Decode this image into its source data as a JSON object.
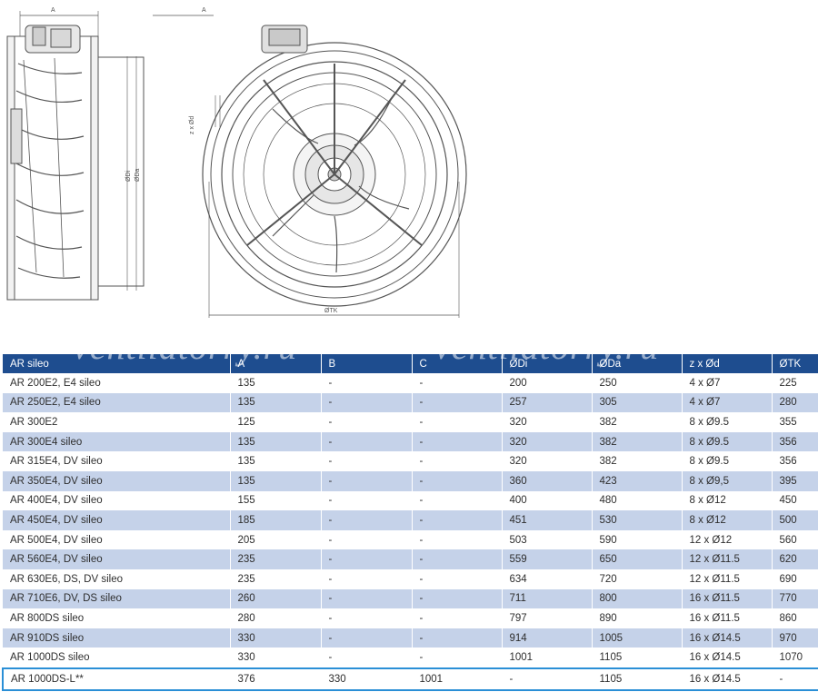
{
  "drawing": {
    "dim_a_side": "A",
    "dim_a_top": "A",
    "dim_di": "ØDi",
    "dim_da": "ØDa",
    "dim_zd": "z x Ød",
    "dim_tk": "ØTK"
  },
  "watermark": [
    "ventilatorry.ru",
    "ventilatorry.ru"
  ],
  "colors": {
    "header_bg": "#1e4d8f",
    "stripe": "#c5d2e9",
    "highlight_border": "#2a8fd6"
  },
  "table": {
    "headers": [
      "AR sileo",
      "A",
      "B",
      "C",
      "ØDi",
      "ØDa",
      "z x Ød",
      "ØTK"
    ],
    "rows": [
      [
        "AR 200E2, E4 sileo",
        "135",
        "-",
        "-",
        "200",
        "250",
        "4 x Ø7",
        "225"
      ],
      [
        "AR 250E2, E4 sileo",
        "135",
        "-",
        "-",
        "257",
        "305",
        "4 x Ø7",
        "280"
      ],
      [
        "AR 300E2",
        "125",
        "-",
        "-",
        "320",
        "382",
        "8 x Ø9.5",
        "355"
      ],
      [
        "AR 300E4 sileo",
        "135",
        "-",
        "-",
        "320",
        "382",
        "8 x Ø9.5",
        "356"
      ],
      [
        "AR 315E4, DV sileo",
        "135",
        "-",
        "-",
        "320",
        "382",
        "8 x Ø9.5",
        "356"
      ],
      [
        "AR 350E4, DV sileo",
        "135",
        "-",
        "-",
        "360",
        "423",
        "8 x Ø9,5",
        "395"
      ],
      [
        "AR 400E4, DV sileo",
        "155",
        "-",
        "-",
        "400",
        "480",
        "8 x Ø12",
        "450"
      ],
      [
        "AR 450E4, DV sileo",
        "185",
        "-",
        "-",
        "451",
        "530",
        "8 x Ø12",
        "500"
      ],
      [
        "AR 500E4, DV sileo",
        "205",
        "-",
        "-",
        "503",
        "590",
        "12 x Ø12",
        "560"
      ],
      [
        "AR 560E4, DV sileo",
        "235",
        "-",
        "-",
        "559",
        "650",
        "12 x Ø11.5",
        "620"
      ],
      [
        "AR 630E6, DS, DV sileo",
        "235",
        "-",
        "-",
        "634",
        "720",
        "12 x Ø11.5",
        "690"
      ],
      [
        "AR 710E6, DV, DS sileo",
        "260",
        "-",
        "-",
        "711",
        "800",
        "16 x Ø11.5",
        "770"
      ],
      [
        "AR 800DS sileo",
        "280",
        "-",
        "-",
        "797",
        "890",
        "16 x Ø11.5",
        "860"
      ],
      [
        "AR 910DS sileo",
        "330",
        "-",
        "-",
        "914",
        "1005",
        "16 x Ø14.5",
        "970"
      ],
      [
        "AR 1000DS sileo",
        "330",
        "-",
        "-",
        "1001",
        "1105",
        "16 x Ø14.5",
        "1070"
      ],
      [
        "AR 1000DS-L**",
        "376",
        "330",
        "1001",
        "-",
        "1105",
        "16 x Ø14.5",
        "-"
      ]
    ]
  }
}
